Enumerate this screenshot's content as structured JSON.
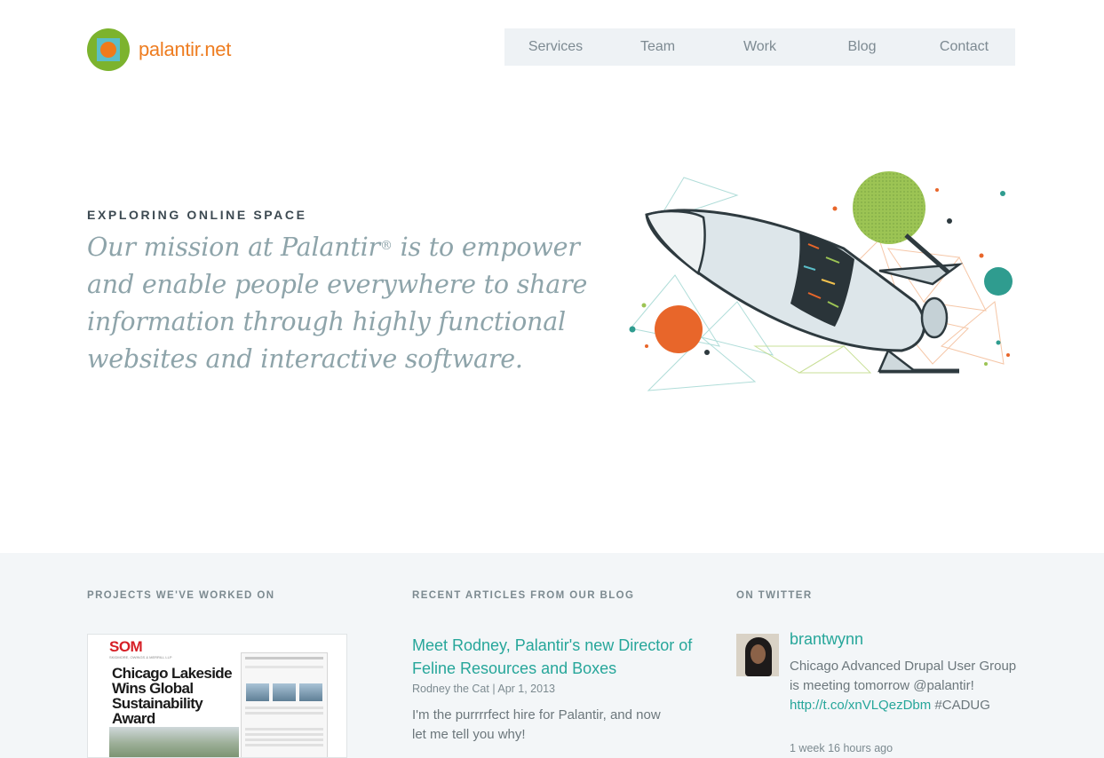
{
  "header": {
    "logo_text": "palantir.net",
    "nav": [
      "Services",
      "Team",
      "Work",
      "Blog",
      "Contact"
    ]
  },
  "hero": {
    "eyebrow": "EXPLORING ONLINE SPACE",
    "mission_before": "Our mission at Palantir",
    "mission_reg": "®",
    "mission_after": " is to empower and enable people everywhere to share information through highly functional websites and interactive software."
  },
  "projects": {
    "heading": "PROJECTS WE'VE WORKED ON",
    "thumb_brand": "SOM",
    "thumb_subtitle": "SKIDMORE, OWINGS & MERRILL LLP",
    "thumb_title": "Chicago Lakeside Wins Global Sustainability Award"
  },
  "blog": {
    "heading": "RECENT ARTICLES FROM OUR BLOG",
    "title": "Meet Rodney, Palantir's new Director of Feline Resources and Boxes",
    "meta": "Rodney the Cat | Apr 1, 2013",
    "excerpt": "I'm the purrrrfect hire for Palantir, and now let me tell you why!"
  },
  "twitter": {
    "heading": "ON TWITTER",
    "user": "brantwynn",
    "text_before": "Chicago Advanced Drupal User Group is meeting tomorrow @palantir! ",
    "link": "http://t.co/xnVLQezDbm",
    "text_after": " #CADUG",
    "time": "1 week 16 hours ago"
  },
  "colors": {
    "accent_teal": "#26a69a",
    "logo_orange": "#ee7d21",
    "logo_green": "#7cb32e",
    "nav_bg": "#eef2f5",
    "band_bg": "#f3f6f8"
  }
}
